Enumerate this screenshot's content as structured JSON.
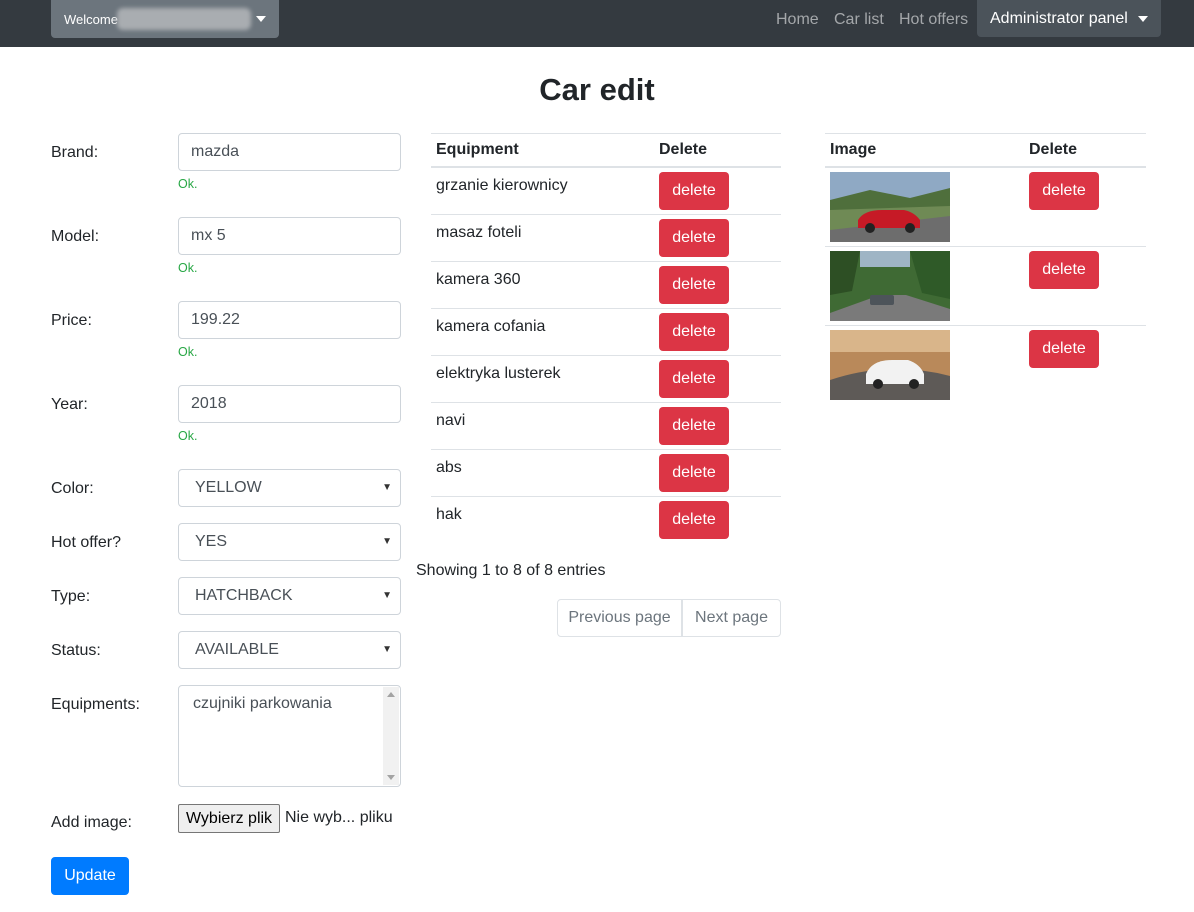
{
  "navbar": {
    "welcome_label": "Welcome",
    "links": [
      "Home",
      "Car list",
      "Hot offers"
    ],
    "admin_label": "Administrator panel"
  },
  "page_title": "Car edit",
  "form": {
    "brand": {
      "label": "Brand:",
      "value": "mazda",
      "status": "Ok."
    },
    "model": {
      "label": "Model:",
      "value": "mx 5",
      "status": "Ok."
    },
    "price": {
      "label": "Price:",
      "value": "199.22",
      "status": "Ok."
    },
    "year": {
      "label": "Year:",
      "value": "2018",
      "status": "Ok."
    },
    "color": {
      "label": "Color:",
      "value": "YELLOW"
    },
    "hot_offer": {
      "label": "Hot offer?",
      "value": "YES"
    },
    "type": {
      "label": "Type:",
      "value": "HATCHBACK"
    },
    "status": {
      "label": "Status:",
      "value": "AVAILABLE"
    },
    "equipments": {
      "label": "Equipments:",
      "value": "czujniki parkowania"
    },
    "add_image": {
      "label": "Add image:",
      "button": "Wybierz plik",
      "status": "Nie wyb... pliku"
    },
    "update_label": "Update"
  },
  "equipment_table": {
    "headers": [
      "Equipment",
      "Delete"
    ],
    "rows": [
      {
        "name": "grzanie kierownicy",
        "action": "delete"
      },
      {
        "name": "masaz foteli",
        "action": "delete"
      },
      {
        "name": "kamera 360",
        "action": "delete"
      },
      {
        "name": "kamera cofania",
        "action": "delete"
      },
      {
        "name": "elektryka lusterek",
        "action": "delete"
      },
      {
        "name": "navi",
        "action": "delete"
      },
      {
        "name": "abs",
        "action": "delete"
      },
      {
        "name": "hak",
        "action": "delete"
      }
    ],
    "showing": "Showing 1 to 8 of 8 entries",
    "prev_label": "Previous page",
    "next_label": "Next page"
  },
  "image_table": {
    "headers": [
      "Image",
      "Delete"
    ],
    "rows": [
      {
        "action": "delete"
      },
      {
        "action": "delete"
      },
      {
        "action": "delete"
      }
    ]
  },
  "colors": {
    "navbar": "#343a40",
    "primary": "#007bff",
    "danger": "#dc3545",
    "success": "#28a745"
  }
}
